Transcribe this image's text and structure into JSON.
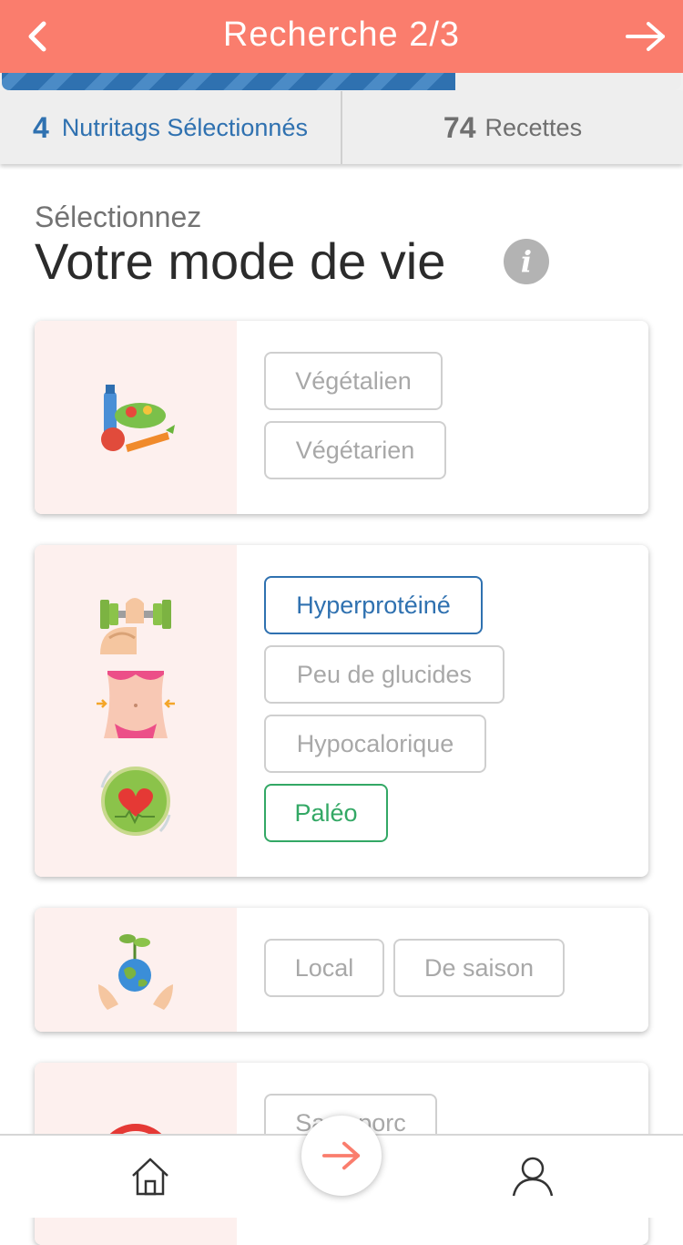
{
  "header": {
    "title": "Recherche 2/3"
  },
  "progress": {
    "fraction": 0.667
  },
  "stats": {
    "selected_count": "4",
    "selected_label": "Nutritags Sélectionnés",
    "recipes_count": "74",
    "recipes_label": "Recettes"
  },
  "page": {
    "subtitle": "Sélectionnez",
    "heading": "Votre mode de vie",
    "info_glyph": "i"
  },
  "cards": [
    {
      "icons": [
        "vegetables-icon"
      ],
      "tags": [
        {
          "label": "Végétalien",
          "state": "off"
        },
        {
          "label": "Végétarien",
          "state": "off"
        }
      ]
    },
    {
      "icons": [
        "dumbbell-arm-icon",
        "slim-waist-icon",
        "heart-health-icon"
      ],
      "tags": [
        {
          "label": "Hyperprotéiné",
          "state": "selected-blue"
        },
        {
          "label": "Peu de glucides",
          "state": "off"
        },
        {
          "label": "Hypocalorique",
          "state": "off"
        },
        {
          "label": "Paléo",
          "state": "selected-green"
        }
      ]
    },
    {
      "icons": [
        "earth-plant-hands-icon"
      ],
      "tags": [
        {
          "label": "Local",
          "state": "off"
        },
        {
          "label": "De saison",
          "state": "off"
        }
      ]
    },
    {
      "icons": [
        "no-pork-icon"
      ],
      "tags": [
        {
          "label": "Sans porc",
          "state": "off"
        }
      ]
    }
  ],
  "bottom_nav": {
    "items": [
      "home-icon",
      "next-arrow-icon",
      "user-icon"
    ]
  },
  "colors": {
    "header": "#fa7d6d",
    "accent_blue": "#2f71b0",
    "accent_green": "#33a865",
    "card_side": "#fdf0ee"
  }
}
